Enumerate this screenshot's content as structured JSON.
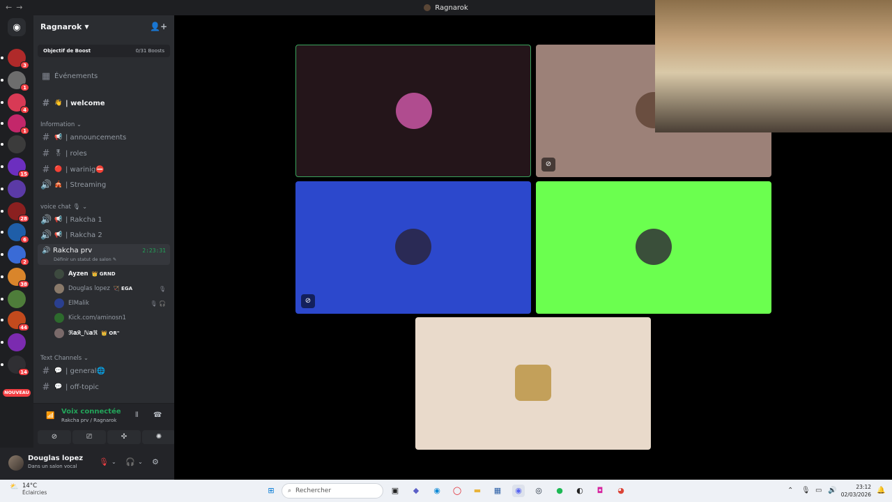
{
  "window": {
    "title": "Ragnarok",
    "nav_back": "←",
    "nav_forward": "→"
  },
  "server": {
    "name": "Ragnarok",
    "boost_label": "Objectif de Boost",
    "boost_count": "0/31 Boosts",
    "events_label": "Événements"
  },
  "guilds": [
    {
      "badge": "3",
      "color": "#b02a2a"
    },
    {
      "badge": "1",
      "color": "#6d6d6d"
    },
    {
      "badge": "4",
      "color": "#d83a55"
    },
    {
      "badge": "1",
      "color": "#c3276a"
    },
    {
      "badge": "",
      "color": "#3b3b3b"
    },
    {
      "badge": "15",
      "color": "#6c2fbf"
    },
    {
      "badge": "",
      "color": "#5b3aa6"
    },
    {
      "badge": "28",
      "color": "#8b2020"
    },
    {
      "badge": "6",
      "color": "#1f5ea8"
    },
    {
      "badge": "2",
      "color": "#3a6bd6"
    },
    {
      "badge": "38",
      "color": "#d9852b"
    },
    {
      "badge": "",
      "color": "#4e7d3a"
    },
    {
      "badge": "44",
      "color": "#c24a1d"
    },
    {
      "badge": "",
      "color": "#7b2bb0"
    },
    {
      "badge": "14",
      "color": "#2f2f33"
    }
  ],
  "nouveau_label": "NOUVEAU",
  "channels": {
    "welcome": {
      "emoji": "👋",
      "name": "| welcome"
    },
    "cat_information": "Information",
    "announcements": {
      "emoji": "📢",
      "name": "| announcements"
    },
    "roles": {
      "emoji": "🎖",
      "name": "| roles"
    },
    "warinig": {
      "emoji": "🔴",
      "name": "| warinig",
      "suffix": "⛔"
    },
    "streaming": {
      "emoji": "🎪",
      "name": "| Streaming"
    },
    "cat_voice": "voice chat",
    "rakcha1": {
      "emoji": "📢",
      "name": "| Rakcha 1"
    },
    "rakcha2": {
      "emoji": "📢",
      "name": "| Rakcha 2"
    },
    "rakcha_prv": {
      "name": "Rakcha prv",
      "timer": "2:23:31",
      "status": "Définir un statut de salon"
    },
    "cat_text": "Text Channels",
    "general": {
      "emoji": "💬",
      "name": "| general",
      "suffix": "🌐"
    },
    "offtopic": {
      "emoji": "💬",
      "name": "| off-topic"
    }
  },
  "members": [
    {
      "name": "Ayzen",
      "tag": "👑 GRND",
      "bold": true,
      "color": "#3d4a3f",
      "icons": ""
    },
    {
      "name": "Douglas lopez",
      "tag": "🏹 EGA",
      "bold": false,
      "color": "#8a7a6a",
      "icons": "🎙"
    },
    {
      "name": "ElMalik",
      "tag": "",
      "bold": false,
      "color": "#2a3f8f",
      "icons": "🎙 🎧"
    },
    {
      "name": "Kick.com/aminosn1",
      "tag": "",
      "bold": false,
      "color": "#2d6a2d",
      "icons": ""
    },
    {
      "name": "ℜa𝔎_ℕaℜ",
      "tag": "👑 OR\"",
      "bold": true,
      "color": "#7a6a6a",
      "icons": ""
    }
  ],
  "voice_panel": {
    "status": "Voix connectée",
    "location": "Rakcha prv / Ragnarok"
  },
  "user": {
    "name": "Douglas lopez",
    "status": "Dans un salon vocal"
  },
  "tiles": [
    {
      "bg": "#24151a",
      "border": "#3ba55d",
      "avatar": "#b04c8f"
    },
    {
      "bg": "#9c8178",
      "avatar": "#6a4e40"
    },
    {
      "bg": "#2c48cc",
      "avatar": "#2a2a55"
    },
    {
      "bg": "#6bff4f",
      "avatar": "#3a4f3a"
    },
    {
      "bg": "#e9dacb",
      "avatar": "#c3a05a"
    }
  ],
  "taskbar": {
    "temp": "14°C",
    "weather": "Éclaircies",
    "search_placeholder": "Rechercher",
    "time": "23:12",
    "date": "02/03/2026"
  }
}
